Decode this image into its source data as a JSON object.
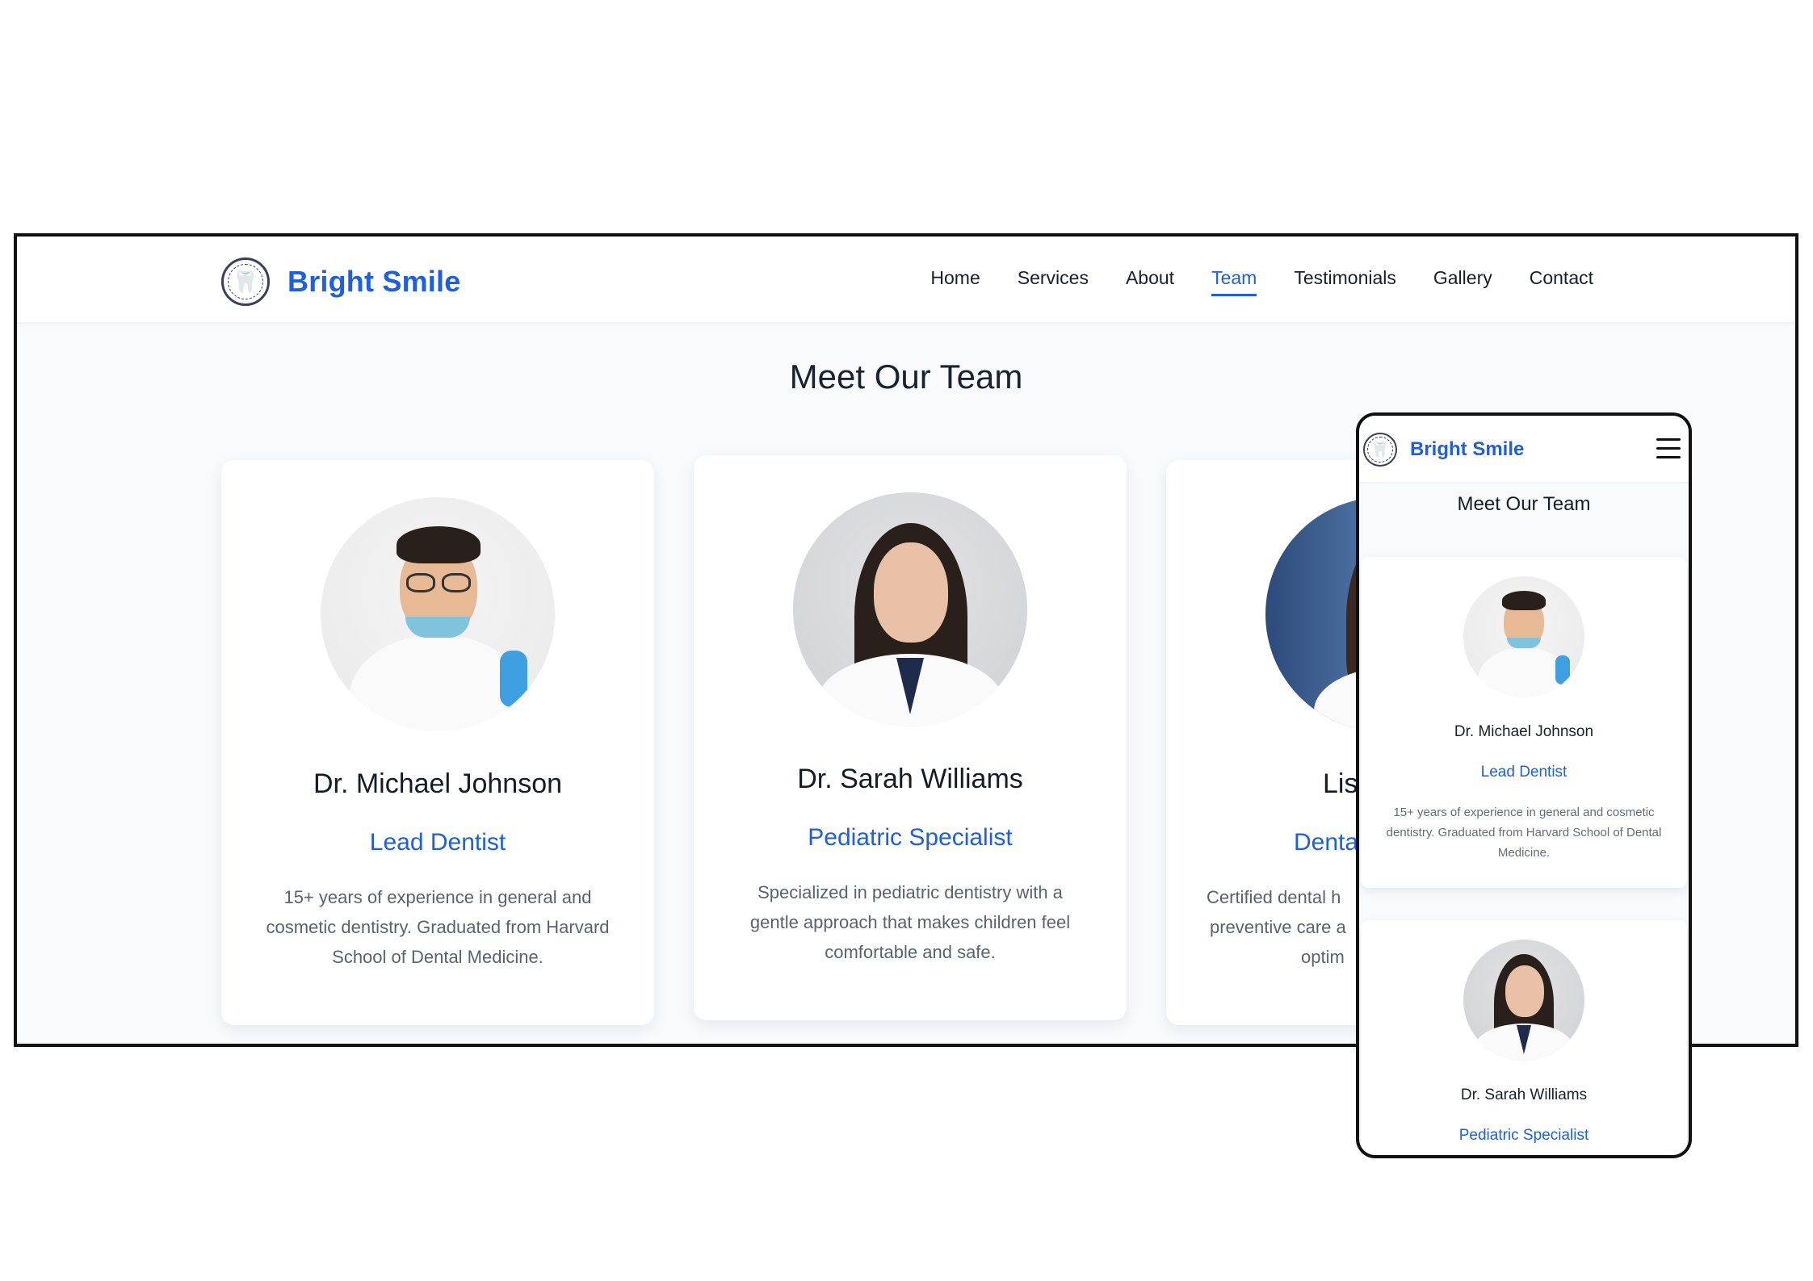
{
  "brand": {
    "name": "Bright Smile",
    "logo_icon": "tooth-logo-icon"
  },
  "nav": {
    "items": [
      "Home",
      "Services",
      "About",
      "Team",
      "Testimonials",
      "Gallery",
      "Contact"
    ],
    "active": "Team"
  },
  "section": {
    "title": "Meet Our Team"
  },
  "team": [
    {
      "name": "Dr. Michael Johnson",
      "role": "Lead Dentist",
      "bio": "15+ years of experience in general and cosmetic dentistry. Graduated from Harvard School of Dental Medicine."
    },
    {
      "name": "Dr. Sarah Williams",
      "role": "Pediatric Specialist",
      "bio": "Specialized in pediatric dentistry with a gentle approach that makes children feel comfortable and safe."
    },
    {
      "name": "Lis",
      "role": "Denta",
      "bio_lines": [
        "Certified dental h",
        "preventive care a",
        "optim"
      ]
    }
  ],
  "mobile": {
    "menu_icon": "hamburger-menu-icon"
  },
  "colors": {
    "accent": "#1d5ee6",
    "text": "#161c27",
    "muted": "#5b616e",
    "page_bg": "#f8fafc"
  }
}
